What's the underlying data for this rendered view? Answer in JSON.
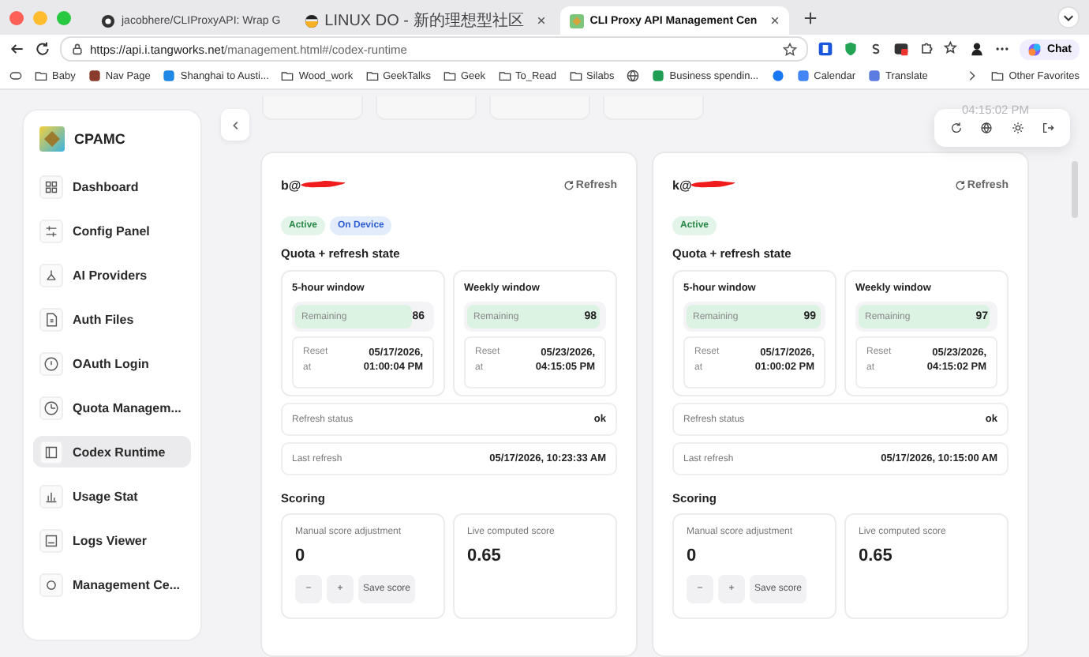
{
  "browser": {
    "tabs": [
      {
        "title": "jacobhere/CLIProxyAPI: Wrap G",
        "kind": "github",
        "selected": false,
        "closable": false
      },
      {
        "title": "LINUX DO - 新的理想型社区",
        "kind": "forum",
        "selected": false,
        "closable": true
      },
      {
        "title": "CLI Proxy API Management Cen",
        "kind": "app",
        "selected": true,
        "closable": true
      }
    ],
    "url": {
      "host": "https://api.i.tangworks.net",
      "path": "/management.html#/codex-runtime"
    },
    "chat_button": "Chat",
    "bookmarks": [
      {
        "label": "Baby",
        "kind": "folder"
      },
      {
        "label": "Nav Page",
        "kind": "site",
        "color": "#8a3b2b"
      },
      {
        "label": "Shanghai to Austi...",
        "kind": "site",
        "color": "#1e88e5"
      },
      {
        "label": "Wood_work",
        "kind": "folder"
      },
      {
        "label": "GeekTalks",
        "kind": "folder"
      },
      {
        "label": "Geek",
        "kind": "folder"
      },
      {
        "label": "To_Read",
        "kind": "folder"
      },
      {
        "label": "Silabs",
        "kind": "folder"
      },
      {
        "kind": "globe"
      },
      {
        "label": "Business spendin...",
        "kind": "site",
        "color": "#1f9d55"
      },
      {
        "kind": "site",
        "color": "#1877f2"
      },
      {
        "label": "Calendar",
        "kind": "site",
        "color": "#4285f4"
      },
      {
        "label": "Translate",
        "kind": "site",
        "color": "#5b7be0"
      }
    ],
    "other_favorites": "Other Favorites"
  },
  "sidebar": {
    "logo_text": "CPAMC",
    "items": [
      {
        "label": "Dashboard",
        "selected": false
      },
      {
        "label": "Config Panel",
        "selected": false
      },
      {
        "label": "AI Providers",
        "selected": false
      },
      {
        "label": "Auth Files",
        "selected": false
      },
      {
        "label": "OAuth Login",
        "selected": false
      },
      {
        "label": "Quota Managem...",
        "selected": false
      },
      {
        "label": "Codex Runtime",
        "selected": true
      },
      {
        "label": "Usage Stat",
        "selected": false
      },
      {
        "label": "Logs Viewer",
        "selected": false
      },
      {
        "label": "Management Ce...",
        "selected": false
      }
    ]
  },
  "header": {
    "clock": "04:15:02 PM"
  },
  "accounts": [
    {
      "email": "b@",
      "refresh_button": "Refresh",
      "badges": [
        {
          "label": "Active",
          "kind": "active"
        },
        {
          "label": "On Device",
          "kind": "device"
        }
      ],
      "quota_title": "Quota + refresh state",
      "windows": [
        {
          "title": "5-hour window",
          "remaining_label": "Remaining",
          "remaining": "86",
          "level": 0.86,
          "reset_label": "Reset at",
          "reset_value": "05/17/2026, 01:00:04 PM"
        },
        {
          "title": "Weekly window",
          "remaining_label": "Remaining",
          "remaining": "98",
          "level": 0.98,
          "reset_label": "Reset at",
          "reset_value": "05/23/2026, 04:15:05 PM"
        }
      ],
      "refresh_status_label": "Refresh status",
      "refresh_status": "ok",
      "last_refresh_label": "Last refresh",
      "last_refresh": "05/17/2026, 10:23:33 AM",
      "scoring_title": "Scoring",
      "manual_label": "Manual score adjustment",
      "manual_value": "0",
      "minus": "−",
      "plus": "+",
      "save": "Save score",
      "live_label": "Live computed score",
      "live_value": "0.65"
    },
    {
      "email": "k@",
      "refresh_button": "Refresh",
      "badges": [
        {
          "label": "Active",
          "kind": "active"
        }
      ],
      "quota_title": "Quota + refresh state",
      "windows": [
        {
          "title": "5-hour window",
          "remaining_label": "Remaining",
          "remaining": "99",
          "level": 0.99,
          "reset_label": "Reset at",
          "reset_value": "05/17/2026, 01:00:02 PM"
        },
        {
          "title": "Weekly window",
          "remaining_label": "Remaining",
          "remaining": "97",
          "level": 0.97,
          "reset_label": "Reset at",
          "reset_value": "05/23/2026, 04:15:02 PM"
        }
      ],
      "refresh_status_label": "Refresh status",
      "refresh_status": "ok",
      "last_refresh_label": "Last refresh",
      "last_refresh": "05/17/2026, 10:15:00 AM",
      "scoring_title": "Scoring",
      "manual_label": "Manual score adjustment",
      "manual_value": "0",
      "minus": "−",
      "plus": "+",
      "save": "Save score",
      "live_label": "Live computed score",
      "live_value": "0.65"
    }
  ]
}
